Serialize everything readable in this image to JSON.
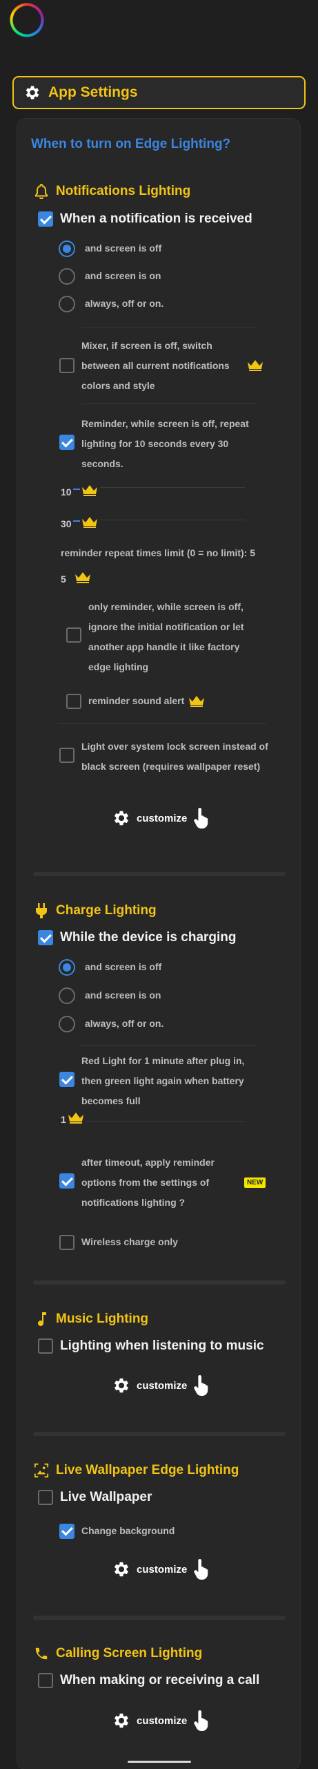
{
  "header": {
    "title": "App Settings"
  },
  "question": "When to turn on Edge Lighting?",
  "notifications": {
    "title": "Notifications Lighting",
    "main": "When a notification is received",
    "radios": [
      "and screen is off",
      "and screen is on",
      "always, off or on."
    ],
    "mixer": [
      "Mixer, if screen is off, switch",
      "between all current notifications",
      "colors and style"
    ],
    "reminder": [
      "Reminder, while screen is off, repeat",
      "lighting for 10 seconds every 30",
      "seconds."
    ],
    "slider1_value": "10",
    "slider2_value": "30",
    "repeat_limit": "reminder repeat times limit (0 = no limit): 5",
    "slider3_value": "5",
    "only_reminder": [
      "only reminder, while screen is off,",
      "ignore the initial notification or let",
      "another app handle it like factory",
      "edge lighting"
    ],
    "sound_alert": "reminder sound alert",
    "lock_screen": [
      "Light over system lock screen instead of",
      "black screen (requires wallpaper reset)"
    ],
    "customize": "customize"
  },
  "charge": {
    "title": "Charge Lighting",
    "main": "While the device is charging",
    "radios": [
      "and screen is off",
      "and screen is on",
      "always, off or on."
    ],
    "red_light": [
      "Red Light for 1 minute after plug in,",
      "then green light again when battery",
      "becomes full"
    ],
    "slider_value": "1",
    "after_timeout": [
      "after timeout, apply reminder",
      "options from the settings of",
      "notifications lighting ?"
    ],
    "new_badge": "NEW",
    "wireless": "Wireless charge only"
  },
  "music": {
    "title": "Music Lighting",
    "main": "Lighting when listening to music",
    "customize": "customize"
  },
  "wallpaper": {
    "title": "Live Wallpaper Edge Lighting",
    "main": "Live Wallpaper",
    "change_bg": "Change background",
    "customize": "customize"
  },
  "calling": {
    "title": "Calling Screen Lighting",
    "main": "When making or receiving a call",
    "customize": "customize"
  },
  "colors": {
    "accent": "#f2c414",
    "blue": "#3a86e0",
    "background": "#1f1f1f"
  }
}
